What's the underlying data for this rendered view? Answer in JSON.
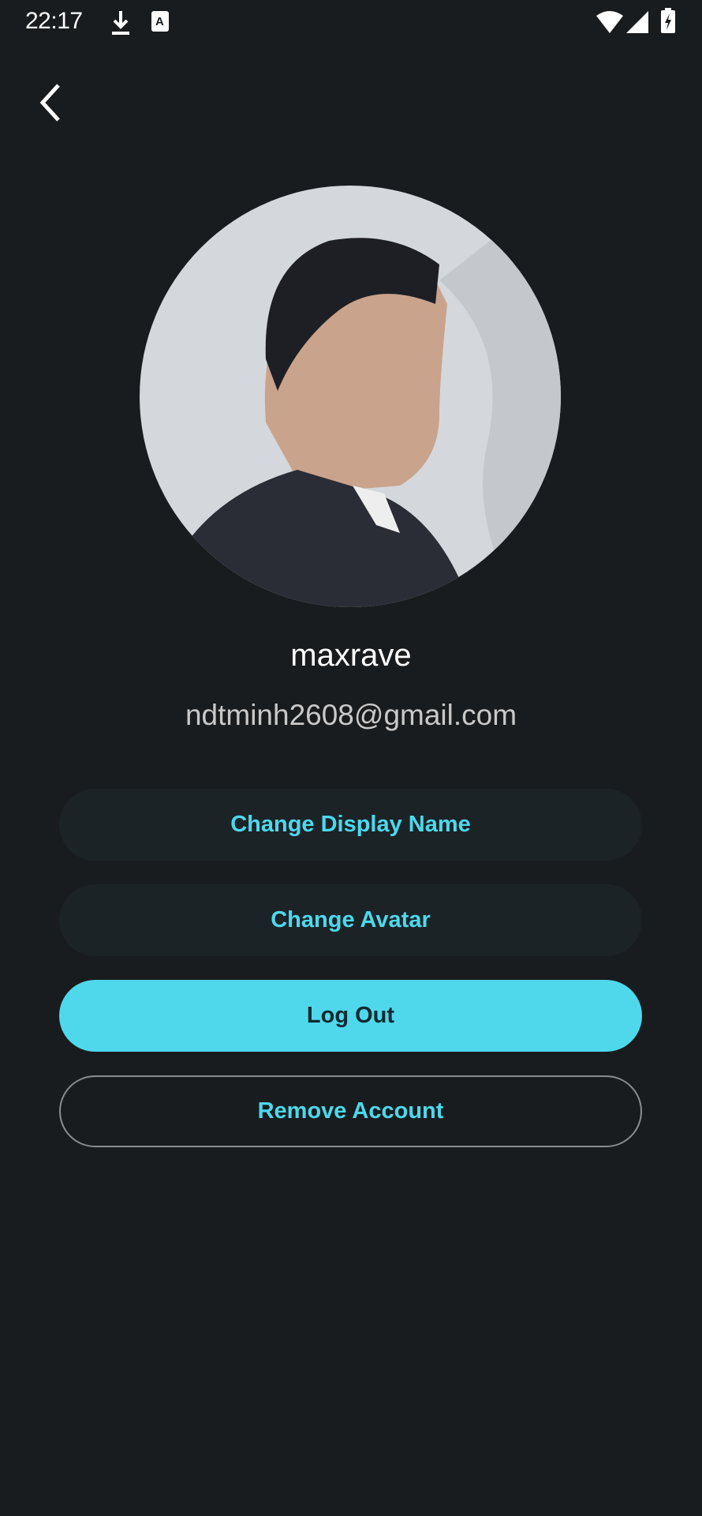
{
  "status_bar": {
    "time": "22:17",
    "icons": [
      "download-icon",
      "font-a-icon",
      "wifi-icon",
      "signal-icon",
      "battery-charging-icon"
    ]
  },
  "header": {
    "back_icon": "chevron-left-icon"
  },
  "profile": {
    "display_name": "maxrave",
    "email": "ndtminh2608@gmail.com"
  },
  "actions": {
    "change_display_name": "Change Display Name",
    "change_avatar": "Change Avatar",
    "log_out": "Log Out",
    "remove_account": "Remove Account"
  },
  "colors": {
    "background": "#191c1e",
    "accent": "#4fd8ec",
    "tonal_button": "#1c2327"
  }
}
